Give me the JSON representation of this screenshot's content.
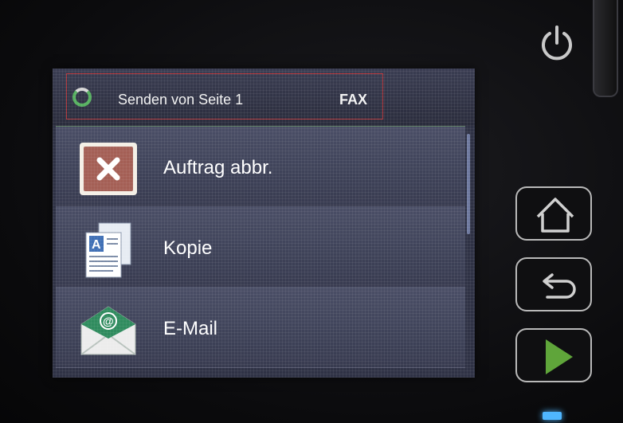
{
  "status": {
    "text": "Senden von Seite 1",
    "mode": "FAX"
  },
  "menu": {
    "items": [
      {
        "label": "Auftrag abbr.",
        "icon": "cancel-icon"
      },
      {
        "label": "Kopie",
        "icon": "copy-icon"
      },
      {
        "label": "E-Mail",
        "icon": "email-icon"
      }
    ]
  },
  "hardware_buttons": [
    "power-icon",
    "home-icon",
    "back-icon",
    "start-icon"
  ],
  "colors": {
    "screen_bg": "#2f3245",
    "status_border": "#b2373c",
    "spinner": "#56b060",
    "cancel_icon_bg": "#a45f55",
    "start_green": "#5fa53a",
    "led": "#4fb6ff"
  }
}
